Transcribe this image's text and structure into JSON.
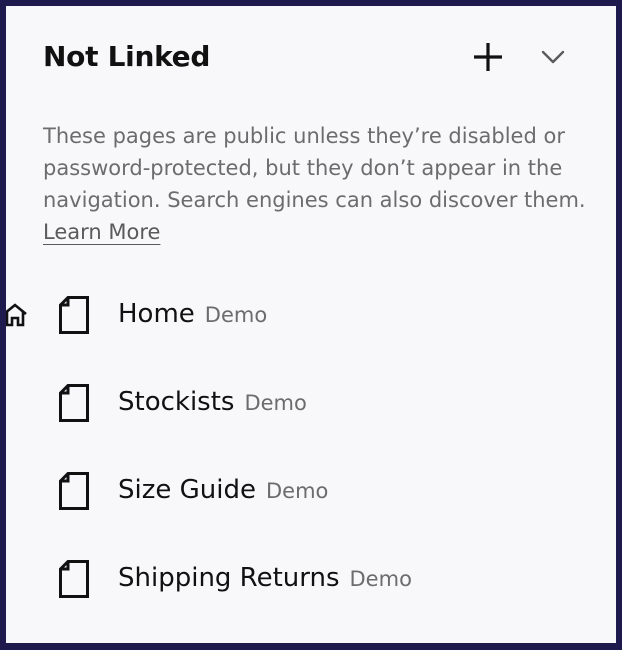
{
  "section": {
    "title": "Not Linked",
    "description": "These pages are public unless they’re disabled or password-protected, but they don’t appear in the navigation. Search engines can also discover them.",
    "learn_more": "Learn More"
  },
  "pages": [
    {
      "name": "Home",
      "tag": "Demo",
      "is_homepage": true
    },
    {
      "name": "Stockists",
      "tag": "Demo",
      "is_homepage": false
    },
    {
      "name": "Size Guide",
      "tag": "Demo",
      "is_homepage": false
    },
    {
      "name": "Shipping Returns",
      "tag": "Demo",
      "is_homepage": false
    }
  ],
  "icons": {
    "add": "plus-icon",
    "collapse": "chevron-down-icon",
    "page": "page-icon",
    "homepage": "home-icon"
  },
  "colors": {
    "frame": "#1f1a4d",
    "panel": "#f8f7fa",
    "text": "#111111",
    "muted": "#6c6c6c"
  }
}
